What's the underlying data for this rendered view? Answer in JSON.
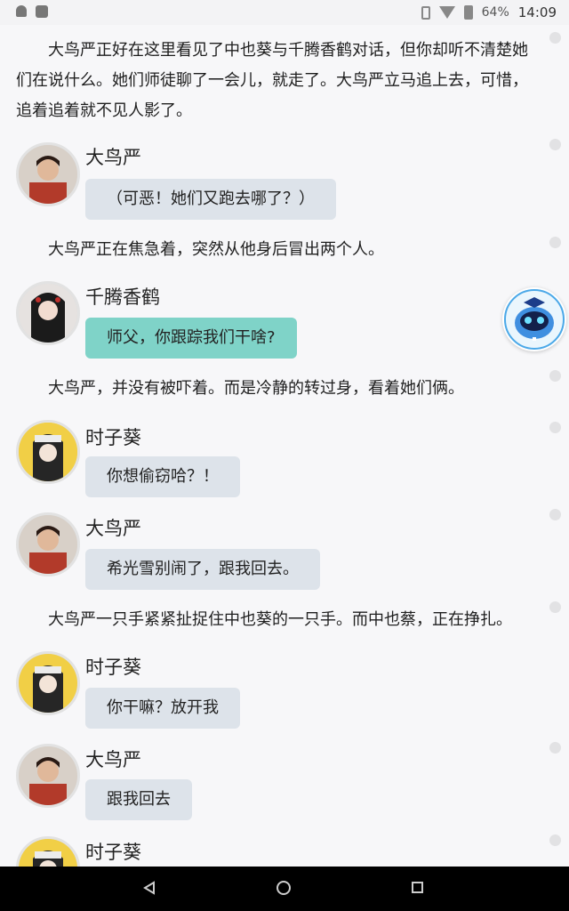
{
  "status_bar": {
    "battery": "64%",
    "time": "14:09",
    "icons": [
      "notification-bell-icon",
      "image-icon",
      "vibrate-icon",
      "wifi-icon",
      "battery-icon"
    ]
  },
  "story": {
    "intro": "大鸟严正好在这里看见了中也葵与千腾香鹤对话，但你却听不清楚她们在说什么。她们师徒聊了一会儿，就走了。大鸟严立马追上去，可惜，追着追着就不见人影了。",
    "msg1": {
      "name": "大鸟严",
      "text": "（可恶！她们又跑去哪了？）"
    },
    "narr2": "大鸟严正在焦急着，突然从他身后冒出两个人。",
    "msg2": {
      "name": "千腾香鹤",
      "text": "师父，你跟踪我们干啥?"
    },
    "narr3": "大鸟严，并没有被吓着。而是冷静的转过身，看着她们俩。",
    "msg3": {
      "name": "时子葵",
      "text": "你想偷窃哈？！"
    },
    "msg4": {
      "name": "大鸟严",
      "text": "希光雪别闹了，跟我回去。"
    },
    "narr4": "大鸟严一只手紧紧扯捉住中也葵的一只手。而中也蔡，正在挣扎。",
    "msg5": {
      "name": "时子葵",
      "text": "你干嘛？放开我"
    },
    "msg6": {
      "name": "大鸟严",
      "text": "跟我回去"
    },
    "msg7": {
      "name": "时子葵"
    }
  },
  "colors": {
    "bubble_default": "#dde3ea",
    "bubble_teal": "#7fd3c8",
    "background": "#f7f7f9"
  }
}
